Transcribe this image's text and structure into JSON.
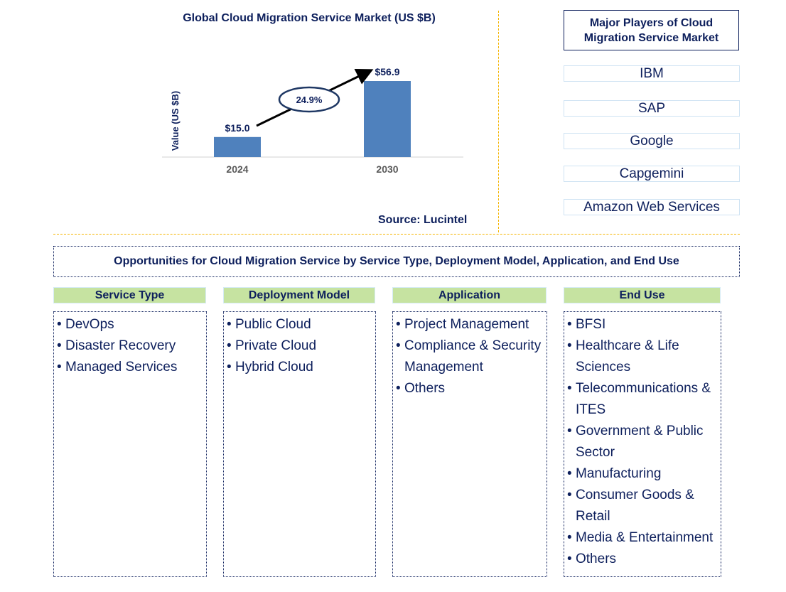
{
  "chart_data": {
    "type": "bar",
    "title": "Global Cloud Migration Service Market (US $B)",
    "xlabel": "",
    "ylabel": "Value (US $B)",
    "categories": [
      "2024",
      "2030"
    ],
    "values": [
      15.0,
      56.9
    ],
    "data_labels": [
      "$15.0",
      "$56.9"
    ],
    "ylim": [
      0,
      60
    ],
    "grid": false,
    "bar_color": "#4f81bd",
    "annotation": {
      "text": "24.9%",
      "meaning": "CAGR arrow from 2024 to 2030"
    }
  },
  "source": "Source: Lucintel",
  "players": {
    "header": "Major Players of Cloud Migration Service Market",
    "items": [
      "IBM",
      "SAP",
      "Google",
      "Capgemini",
      "Amazon Web Services"
    ]
  },
  "opportunities": {
    "title": "Opportunities for Cloud Migration Service by Service Type, Deployment Model, Application, and End Use",
    "categories": [
      {
        "label": "Service Type",
        "items": [
          "DevOps",
          "Disaster Recovery",
          "Managed Services"
        ]
      },
      {
        "label": "Deployment Model",
        "items": [
          "Public Cloud",
          "Private Cloud",
          "Hybrid Cloud"
        ]
      },
      {
        "label": "Application",
        "items": [
          "Project Management",
          "Compliance & Security Management",
          "Others"
        ]
      },
      {
        "label": "End Use",
        "items": [
          "BFSI",
          "Healthcare & Life Sciences",
          "Telecommunications & ITES",
          "Government & Public Sector",
          "Manufacturing",
          "Consumer Goods & Retail",
          "Media & Entertainment",
          "Others"
        ]
      }
    ]
  },
  "colors": {
    "text_navy": "#0d1f5c",
    "bar_blue": "#4f81bd",
    "category_green": "#c6e3a1",
    "divider_gold": "#f5b400"
  }
}
